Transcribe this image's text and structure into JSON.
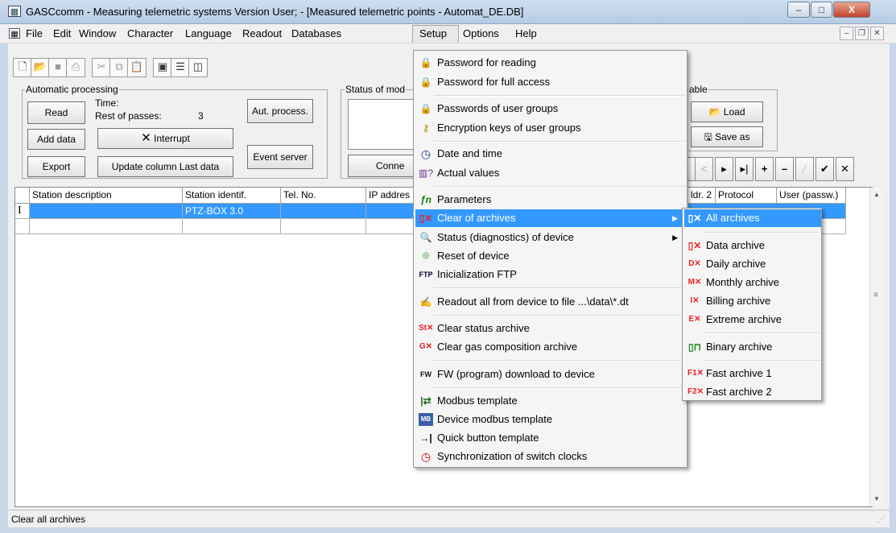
{
  "window": {
    "title": "GASCcomm - Measuring telemetric systems  Version User;   - [Measured telemetric points - Automat_DE.DB]",
    "minimize": "–",
    "maximize": "□",
    "close": "X"
  },
  "menubar": {
    "items": [
      "File",
      "Edit",
      "Window",
      "Character",
      "Language",
      "Readout",
      "Databases",
      "Setup",
      "Options",
      "Help"
    ]
  },
  "toolbar_icons": [
    "new-icon",
    "open-icon",
    "save-icon",
    "print-icon",
    "cut-icon",
    "copy-icon",
    "paste-icon",
    "cascade-icon",
    "tile-horizontal-icon",
    "tile-vertical-icon"
  ],
  "automatic_processing": {
    "label": "Automatic processing",
    "read": "Read",
    "time_label": "Time:",
    "rest_label": "Rest of passes:",
    "rest_value": "3",
    "aut_process": "Aut. process.",
    "add_data": "Add data",
    "interrupt": "Interrupt",
    "event_server": "Event server",
    "export": "Export",
    "update_column": "Update column Last data"
  },
  "status_group": {
    "label": "Status of mod",
    "connect": "Conne"
  },
  "table_group": {
    "label": "able",
    "load": "Load",
    "save_as": "Save as"
  },
  "grid": {
    "headers": [
      "Station description",
      "Station identif.",
      "Tel. No.",
      "IP addres",
      "ldr. 2",
      "Protocol",
      "User (passw.)"
    ],
    "rows": [
      {
        "marker": "I",
        "description": "",
        "identif": "PTZ-BOX 3.0",
        "tel": "",
        "ip": ""
      },
      {
        "marker": "",
        "description": "",
        "identif": "",
        "tel": "",
        "ip": ""
      }
    ]
  },
  "setup_menu": {
    "items": [
      {
        "icon": "lock-yellow-icon",
        "label": "Password for reading"
      },
      {
        "icon": "lock-red-icon",
        "label": "Password for full access"
      },
      {
        "icon": "lock-group-icon",
        "label": "Passwords of user groups"
      },
      {
        "icon": "key-icon",
        "label": "Encryption keys of user groups"
      },
      {
        "icon": "clock-icon",
        "label": "Date and time"
      },
      {
        "icon": "actual-values-icon",
        "label": "Actual values"
      },
      {
        "icon": "parameters-icon",
        "label": "Parameters"
      },
      {
        "icon": "clear-archive-icon",
        "label": "Clear of archives"
      },
      {
        "icon": "diagnostics-icon",
        "label": "Status (diagnostics) of device"
      },
      {
        "icon": "reset-icon",
        "label": "Reset of device"
      },
      {
        "icon": "ftp-icon",
        "label": "Inicialization FTP"
      },
      {
        "icon": "readout-file-icon",
        "label": "Readout all from device to file ...\\data\\*.dt"
      },
      {
        "icon": "clear-status-icon",
        "label": "Clear status archive"
      },
      {
        "icon": "clear-gas-icon",
        "label": "Clear gas composition archive"
      },
      {
        "icon": "fw-download-icon",
        "label": "FW (program) download to device"
      },
      {
        "icon": "modbus-template-icon",
        "label": "Modbus template"
      },
      {
        "icon": "device-modbus-icon",
        "label": "Device modbus template"
      },
      {
        "icon": "quick-button-icon",
        "label": "Quick button template"
      },
      {
        "icon": "sync-clock-icon",
        "label": "Synchronization of switch clocks"
      }
    ]
  },
  "clear_submenu": {
    "items": [
      {
        "icon": "all-archives-icon",
        "label": "All archives"
      },
      {
        "icon": "data-archive-icon",
        "label": "Data archive"
      },
      {
        "icon": "daily-archive-icon",
        "label": "Daily archive"
      },
      {
        "icon": "monthly-archive-icon",
        "label": "Monthly archive"
      },
      {
        "icon": "billing-archive-icon",
        "label": "Billing archive"
      },
      {
        "icon": "extreme-archive-icon",
        "label": "Extreme archive"
      },
      {
        "icon": "binary-archive-icon",
        "label": "Binary archive"
      },
      {
        "icon": "fast-archive-1-icon",
        "label": "Fast archive 1"
      },
      {
        "icon": "fast-archive-2-icon",
        "label": "Fast archive 2"
      }
    ]
  },
  "statusbar": {
    "text": "Clear all archives"
  },
  "colors": {
    "highlight": "#3399ff",
    "close": "#c3432a"
  }
}
